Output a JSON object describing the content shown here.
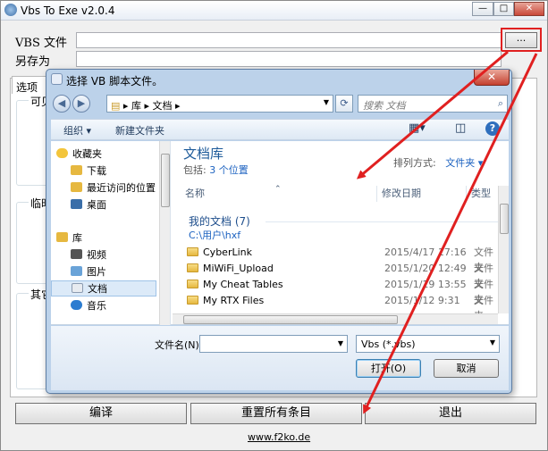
{
  "main": {
    "title": "Vbs To Exe v2.0.4",
    "vbs_label": "VBS 文件",
    "saveas_label": "另存为",
    "browse_label": "...",
    "tab_options": "选项",
    "group1_partial": "可见",
    "group2_partial": "临时",
    "group3_partial": "其它",
    "compile_label": "编译",
    "reset_label": "重置所有条目",
    "exit_label": "退出",
    "website": "www.f2ko.de",
    "highlight_color": "#e02020"
  },
  "dialog": {
    "title": "选择 VB 脚本文件。",
    "breadcrumb": [
      "库",
      "文档"
    ],
    "search_placeholder": "搜索 文档",
    "toolbar": {
      "organize": "组织 ▾",
      "new_folder": "新建文件夹"
    },
    "nav": {
      "favorites": "收藏夹",
      "downloads": "下载",
      "recent": "最近访问的位置",
      "desktop": "桌面",
      "libraries": "库",
      "videos": "视频",
      "pictures": "图片",
      "documents": "文档",
      "music": "音乐"
    },
    "library_title": "文档库",
    "includes_prefix": "包括:",
    "includes_link": "3 个位置",
    "arrange_prefix": "排列方式:",
    "arrange_value": "文件夹 ▾",
    "columns": {
      "name": "名称",
      "date": "修改日期",
      "type": "类型"
    },
    "group_title": "我的文档 (7)",
    "group_path": "C:\\用户\\hxf",
    "files": [
      {
        "name": "CyberLink",
        "date": "2015/4/17 17:16",
        "type": "文件夹"
      },
      {
        "name": "MiWiFi_Upload",
        "date": "2015/1/20 12:49",
        "type": "文件夹"
      },
      {
        "name": "My Cheat Tables",
        "date": "2015/1/19 13:55",
        "type": "文件夹"
      },
      {
        "name": "My RTX Files",
        "date": "2015/1/12 9:31",
        "type": "文件夹"
      }
    ],
    "filename_label": "文件名(N):",
    "filename_value": "",
    "filter_value": "Vbs (*.vbs)",
    "open_label": "打开(O)",
    "cancel_label": "取消"
  }
}
